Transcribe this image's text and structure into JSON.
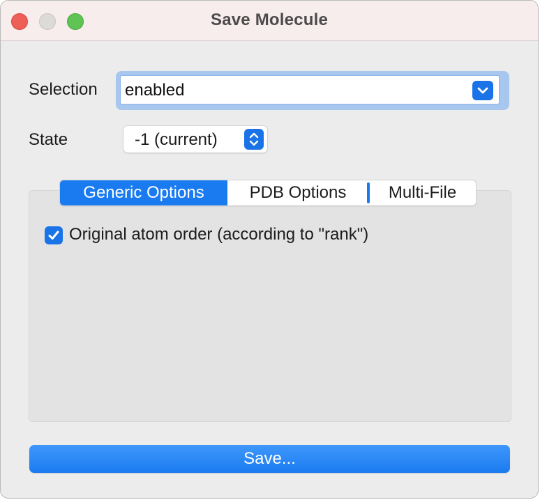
{
  "window": {
    "title": "Save Molecule"
  },
  "form": {
    "selection_label": "Selection",
    "selection_value": "enabled",
    "state_label": "State",
    "state_value": "-1 (current)"
  },
  "tabs": [
    {
      "label": "Generic Options",
      "active": true
    },
    {
      "label": "PDB Options",
      "active": false
    },
    {
      "label": "Multi-File",
      "active": false
    }
  ],
  "generic_options": {
    "original_atom_order_label": "Original atom order (according to \"rank\")",
    "original_atom_order_checked": true
  },
  "actions": {
    "save_label": "Save..."
  },
  "colors": {
    "accent": "#1a7bf0",
    "titlebar": "#f8eded",
    "window_bg": "#ececec",
    "pane_bg": "#e3e3e3",
    "traffic_close": "#ee5f58",
    "traffic_minimize": "#dddada",
    "traffic_zoom": "#5fc453"
  },
  "icons": {
    "dropdown": "chevron-down-icon",
    "stepper": "up-down-chevron-icon",
    "checkbox": "checkmark-icon"
  }
}
